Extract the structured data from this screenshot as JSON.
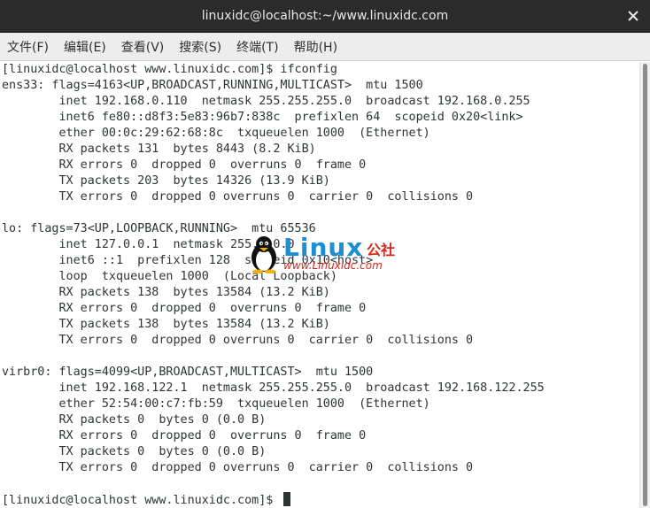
{
  "window": {
    "title": "linuxidc@localhost:~/www.linuxidc.com"
  },
  "menu": [
    {
      "label": "文件(F)"
    },
    {
      "label": "编辑(E)"
    },
    {
      "label": "查看(V)"
    },
    {
      "label": "搜索(S)"
    },
    {
      "label": "终端(T)"
    },
    {
      "label": "帮助(H)"
    }
  ],
  "terminal": {
    "lines": [
      "[linuxidc@localhost www.linuxidc.com]$ ifconfig",
      "ens33: flags=4163<UP,BROADCAST,RUNNING,MULTICAST>  mtu 1500",
      "        inet 192.168.0.110  netmask 255.255.255.0  broadcast 192.168.0.255",
      "        inet6 fe80::d8f3:5e83:96b7:838c  prefixlen 64  scopeid 0x20<link>",
      "        ether 00:0c:29:62:68:8c  txqueuelen 1000  (Ethernet)",
      "        RX packets 131  bytes 8443 (8.2 KiB)",
      "        RX errors 0  dropped 0  overruns 0  frame 0",
      "        TX packets 203  bytes 14326 (13.9 KiB)",
      "        TX errors 0  dropped 0 overruns 0  carrier 0  collisions 0",
      "",
      "lo: flags=73<UP,LOOPBACK,RUNNING>  mtu 65536",
      "        inet 127.0.0.1  netmask 255.0.0.0",
      "        inet6 ::1  prefixlen 128  scopeid 0x10<host>",
      "        loop  txqueuelen 1000  (Local Loopback)",
      "        RX packets 138  bytes 13584 (13.2 KiB)",
      "        RX errors 0  dropped 0  overruns 0  frame 0",
      "        TX packets 138  bytes 13584 (13.2 KiB)",
      "        TX errors 0  dropped 0 overruns 0  carrier 0  collisions 0",
      "",
      "virbr0: flags=4099<UP,BROADCAST,MULTICAST>  mtu 1500",
      "        inet 192.168.122.1  netmask 255.255.255.0  broadcast 192.168.122.255",
      "        ether 52:54:00:c7:fb:59  txqueuelen 1000  (Ethernet)",
      "        RX packets 0  bytes 0 (0.0 B)",
      "        RX errors 0  dropped 0  overruns 0  frame 0",
      "        TX packets 0  bytes 0 (0.0 B)",
      "        TX errors 0  dropped 0 overruns 0  carrier 0  collisions 0",
      "",
      "[linuxidc@localhost www.linuxidc.com]$ "
    ]
  },
  "watermark": {
    "logo_text": "Linux",
    "logo_suffix": "公社",
    "url": "www.Linuxidc.com"
  },
  "colors": {
    "titlebar_bg": "#2b2b2b",
    "menubar_bg": "#ededed",
    "terminal_bg": "#ffffff",
    "terminal_fg": "#2e3436",
    "watermark_blue": "#1a8fd6",
    "watermark_red": "#d9261c"
  },
  "icons": {
    "close": "close-icon",
    "watermark": "penguin-icon"
  }
}
